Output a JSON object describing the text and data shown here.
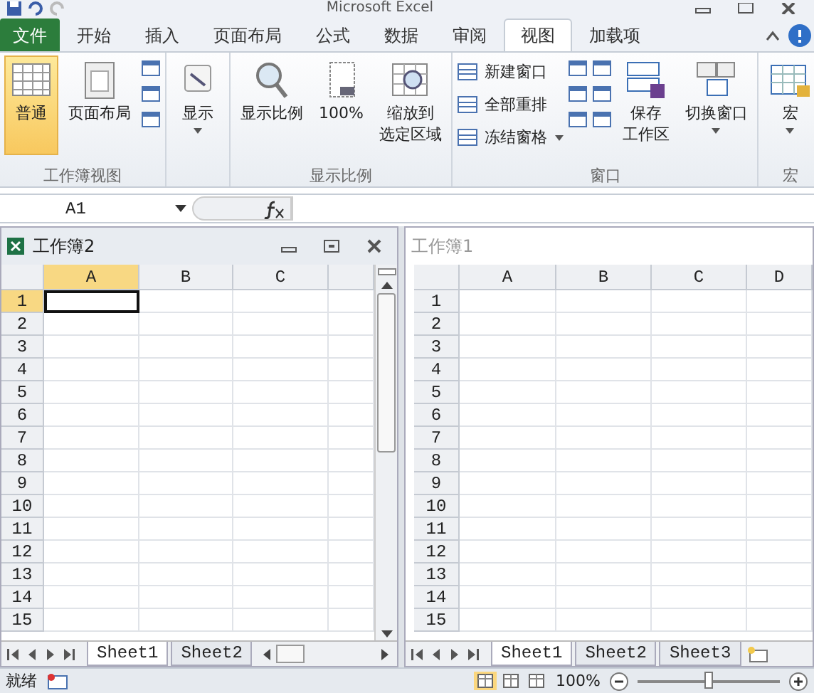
{
  "window": {
    "title": "Microsoft Excel"
  },
  "tabs": [
    {
      "label": "文件",
      "kind": "file",
      "selected": false
    },
    {
      "label": "开始",
      "kind": "tab",
      "selected": false
    },
    {
      "label": "插入",
      "kind": "tab",
      "selected": false
    },
    {
      "label": "页面布局",
      "kind": "tab",
      "selected": false
    },
    {
      "label": "公式",
      "kind": "tab",
      "selected": false
    },
    {
      "label": "数据",
      "kind": "tab",
      "selected": false
    },
    {
      "label": "审阅",
      "kind": "tab",
      "selected": false
    },
    {
      "label": "视图",
      "kind": "tab",
      "selected": true
    },
    {
      "label": "加载项",
      "kind": "tab",
      "selected": false
    }
  ],
  "ribbon_groups": [
    {
      "label": "工作簿视图",
      "items": [
        {
          "kind": "large",
          "label": "普通",
          "selected": true
        },
        {
          "kind": "large",
          "label": "页面布局",
          "selected": false
        },
        {
          "kind": "stack"
        }
      ]
    },
    {
      "items": [
        {
          "kind": "large",
          "label": "显示",
          "dropdown": true,
          "selected": false
        }
      ]
    },
    {
      "label": "显示比例",
      "items": [
        {
          "kind": "large",
          "label": "显示比例",
          "selected": false
        },
        {
          "kind": "large",
          "label": "100%",
          "selected": false
        },
        {
          "kind": "large",
          "lines": [
            "缩放到",
            "选定区域"
          ],
          "selected": false
        }
      ]
    },
    {
      "label": "窗口",
      "items": [
        {
          "kind": "smalllist",
          "entries": [
            {
              "label": "新建窗口",
              "dropdown": false
            },
            {
              "label": "全部重排",
              "dropdown": false
            },
            {
              "label": "冻结窗格",
              "dropdown": true
            }
          ]
        },
        {
          "kind": "stack"
        },
        {
          "kind": "stack"
        },
        {
          "kind": "large",
          "lines": [
            "保存",
            "工作区"
          ],
          "selected": false
        },
        {
          "kind": "large",
          "label": "切换窗口",
          "dropdown": true,
          "selected": false
        }
      ]
    },
    {
      "label": "宏",
      "items": [
        {
          "kind": "large",
          "label": "宏",
          "dropdown": true,
          "selected": false
        }
      ]
    }
  ],
  "formula_bar": {
    "name_box": "A1"
  },
  "workbooks": [
    {
      "title": "工作簿2",
      "active": true,
      "columns": [
        {
          "label": "A",
          "selected": true
        },
        {
          "label": "B",
          "selected": false
        },
        {
          "label": "C",
          "selected": false
        },
        {
          "selected": false
        }
      ],
      "rows": [
        {
          "label": "1",
          "selected": true
        },
        {
          "label": "2",
          "selected": false
        },
        {
          "label": "3",
          "selected": false
        },
        {
          "label": "4",
          "selected": false
        },
        {
          "label": "5",
          "selected": false
        },
        {
          "label": "6",
          "selected": false
        },
        {
          "label": "7",
          "selected": false
        },
        {
          "label": "8",
          "selected": false
        },
        {
          "label": "9",
          "selected": false
        },
        {
          "label": "10",
          "selected": false
        },
        {
          "label": "11",
          "selected": false
        },
        {
          "label": "12",
          "selected": false
        },
        {
          "label": "13",
          "selected": false
        },
        {
          "label": "14",
          "selected": false
        },
        {
          "label": "15",
          "selected": false
        }
      ],
      "sheets": [
        {
          "label": "Sheet1",
          "selected": true
        },
        {
          "label": "Sheet2",
          "selected": false
        }
      ]
    },
    {
      "title": "工作簿1",
      "active": false,
      "columns": [
        {
          "label": "A",
          "selected": false
        },
        {
          "label": "B",
          "selected": false
        },
        {
          "label": "C",
          "selected": false
        },
        {
          "label": "D",
          "selected": false
        }
      ],
      "rows": [
        {
          "label": "1",
          "selected": false
        },
        {
          "label": "2",
          "selected": false
        },
        {
          "label": "3",
          "selected": false
        },
        {
          "label": "4",
          "selected": false
        },
        {
          "label": "5",
          "selected": false
        },
        {
          "label": "6",
          "selected": false
        },
        {
          "label": "7",
          "selected": false
        },
        {
          "label": "8",
          "selected": false
        },
        {
          "label": "9",
          "selected": false
        },
        {
          "label": "10",
          "selected": false
        },
        {
          "label": "11",
          "selected": false
        },
        {
          "label": "12",
          "selected": false
        },
        {
          "label": "13",
          "selected": false
        },
        {
          "label": "14",
          "selected": false
        },
        {
          "label": "15",
          "selected": false
        }
      ],
      "sheets": [
        {
          "label": "Sheet1",
          "selected": true
        },
        {
          "label": "Sheet2",
          "selected": false
        },
        {
          "label": "Sheet3",
          "selected": false
        }
      ]
    }
  ],
  "status_bar": {
    "status": "就绪",
    "zoom": "100%",
    "zoom_slider": {
      "level": 0.5
    },
    "views": [
      {
        "selected": true
      },
      {
        "selected": false
      },
      {
        "selected": false
      }
    ]
  }
}
